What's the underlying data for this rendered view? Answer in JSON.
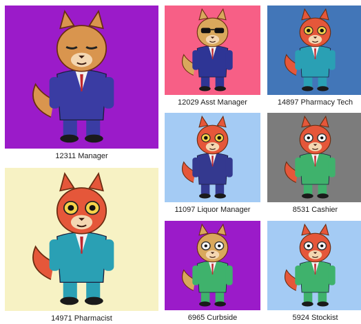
{
  "cards": [
    {
      "label": "12311 Manager",
      "bg": "#9B1BC9",
      "fur": "#D9954E",
      "suit": "#3A3CA3",
      "eyes": "closed"
    },
    {
      "label": "14971 Pharmacist",
      "bg": "#F7F2C4",
      "fur": "#E5573A",
      "suit": "#2AA0B4",
      "eyes": "open"
    },
    {
      "label": "12029 Asst Manager",
      "bg": "#F75F86",
      "fur": "#D9A85C",
      "suit": "#2E3595",
      "eyes": "shades"
    },
    {
      "label": "14897 Pharmacy Tech",
      "bg": "#4276B8",
      "fur": "#E5573A",
      "suit": "#2AA0B4",
      "eyes": "open"
    },
    {
      "label": "11097 Liquor Manager",
      "bg": "#A4CBF4",
      "fur": "#E5573A",
      "suit": "#34398F",
      "eyes": "open"
    },
    {
      "label": "8531 Cashier",
      "bg": "#7C7C7C",
      "fur": "#E5573A",
      "suit": "#3FB26C",
      "eyes": "glasses"
    },
    {
      "label": "6965 Curbside",
      "bg": "#9B1BC9",
      "fur": "#D9A85C",
      "suit": "#3FB26C",
      "eyes": "glasses"
    },
    {
      "label": "5924 Stockist",
      "bg": "#A4CBF4",
      "fur": "#E5573A",
      "suit": "#3FB26C",
      "eyes": "glasses"
    }
  ]
}
